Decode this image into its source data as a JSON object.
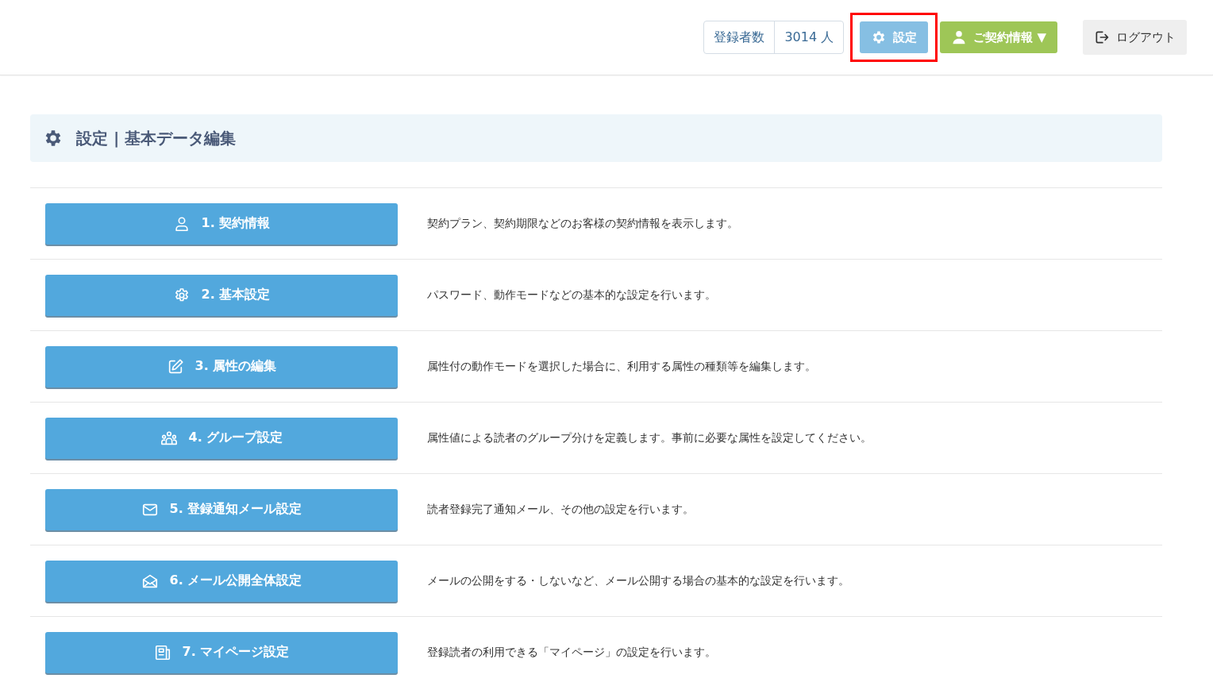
{
  "header": {
    "subscriber_count": {
      "label": "登録者数",
      "value": "3014 人"
    },
    "buttons": [
      {
        "kind": "settings",
        "label": "設定",
        "selected": true,
        "highlighted": true
      },
      {
        "kind": "contract",
        "label": "ご契約情報 ▼",
        "selected": false,
        "highlighted": false
      },
      {
        "kind": "logout",
        "label": "ログアウト",
        "selected": false,
        "highlighted": false
      }
    ]
  },
  "page_title": "設定 | 基本データ編集",
  "menu": [
    {
      "kind": "person",
      "label": "1. 契約情報",
      "description": "契約プラン、契約期限などのお客様の契約情報を表示します。"
    },
    {
      "kind": "gear",
      "label": "2. 基本設定",
      "description": "パスワード、動作モードなどの基本的な設定を行います。"
    },
    {
      "kind": "edit",
      "label": "3. 属性の編集",
      "description": "属性付の動作モードを選択した場合に、利用する属性の種類等を編集します。"
    },
    {
      "kind": "group",
      "label": "4. グループ設定",
      "description": "属性値による読者のグループ分けを定義します。事前に必要な属性を設定してください。"
    },
    {
      "kind": "mail",
      "label": "5. 登録通知メール設定",
      "description": "読者登録完了通知メール、その他の設定を行います。"
    },
    {
      "kind": "mailopen",
      "label": "6. メール公開全体設定",
      "description": "メールの公開をする・しないなど、メール公開する場合の基本的な設定を行います。"
    },
    {
      "kind": "page",
      "label": "7. マイページ設定",
      "description": "登録読者の利用できる「マイページ」の設定を行います。"
    }
  ]
}
